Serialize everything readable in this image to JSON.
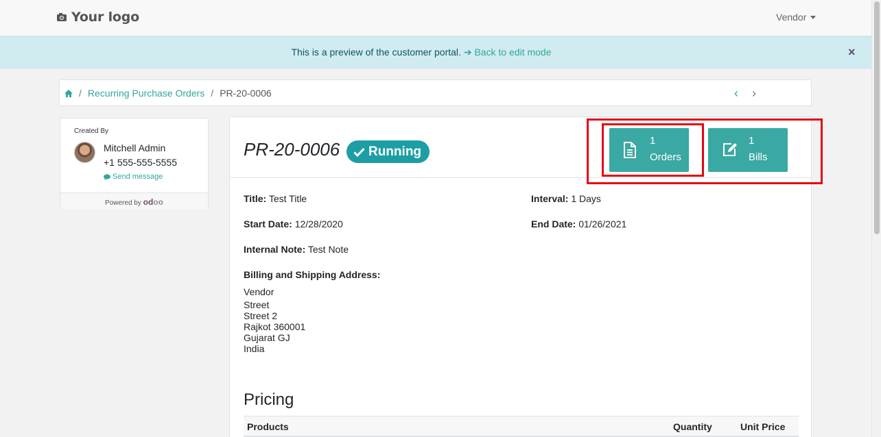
{
  "navbar": {
    "logo_text": "Your logo",
    "user_menu": "Vendor"
  },
  "banner": {
    "message": "This is a preview of the customer portal.",
    "link": "Back to edit mode",
    "close": "×"
  },
  "breadcrumb": {
    "parent": "Recurring Purchase Orders",
    "current": "PR-20-0006"
  },
  "sidebar": {
    "created_by_label": "Created By",
    "name": "Mitchell Admin",
    "phone": "+1 555-555-5555",
    "send_message": "Send message",
    "powered_by": "Powered by",
    "brand_a": "od",
    "brand_b": "oo"
  },
  "order": {
    "name": "PR-20-0006",
    "status": "Running",
    "orders_count": "1",
    "orders_label": "Orders",
    "bills_count": "1",
    "bills_label": "Bills",
    "title_label": "Title:",
    "title_value": "Test Title",
    "interval_label": "Interval:",
    "interval_value": "1 Days",
    "start_label": "Start Date:",
    "start_value": "12/28/2020",
    "end_label": "End Date:",
    "end_value": "01/26/2021",
    "note_label": "Internal Note:",
    "note_value": "Test Note",
    "address_label": "Billing and Shipping Address:",
    "address_lines": [
      "Vendor",
      "Street",
      "Street 2",
      "Rajkot 360001",
      "Gujarat GJ",
      "India"
    ]
  },
  "pricing": {
    "title": "Pricing",
    "columns": [
      "Products",
      "Quantity",
      "Unit Price"
    ]
  },
  "colors": {
    "accent": "#31a69b",
    "stat_button": "#3aa8a3",
    "banner_bg": "#d1ecf1",
    "highlight": "#e30613"
  }
}
